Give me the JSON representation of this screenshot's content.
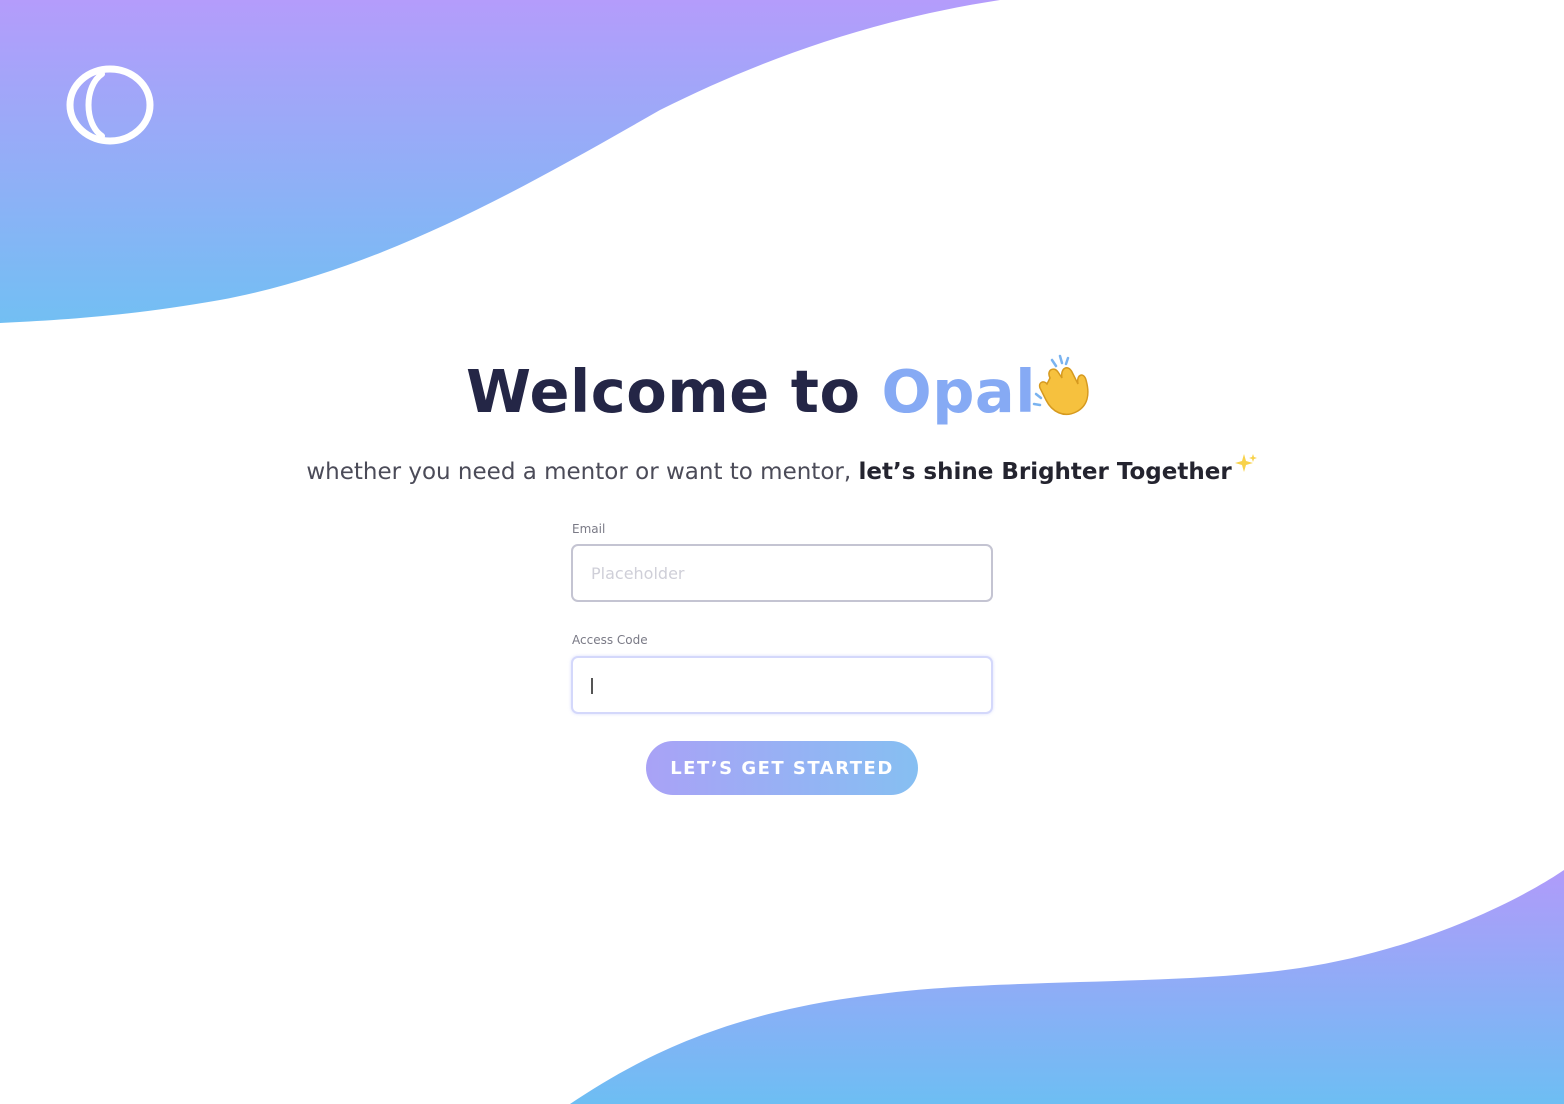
{
  "app": {
    "logo_icon": "opal-ring-logo-icon"
  },
  "hero": {
    "welcome_prefix": "Welcome to ",
    "brand_name": "Opal",
    "wave_icon": "waving-hand-icon",
    "subtitle_regular": "whether you need a mentor or want to mentor, ",
    "subtitle_bold": "let’s shine Brighter Together",
    "sparkle_icon": "sparkles-icon"
  },
  "form": {
    "email_label": "Email",
    "email_placeholder": "Placeholder",
    "email_value": "",
    "access_code_label": "Access Code",
    "access_code_value": "",
    "submit_label": "LET’S GET STARTED"
  },
  "colors": {
    "accent_purple": "#b09cfb",
    "accent_blue": "#6dbdf3",
    "brand_text": "#86aaf4",
    "heading": "#242646"
  }
}
